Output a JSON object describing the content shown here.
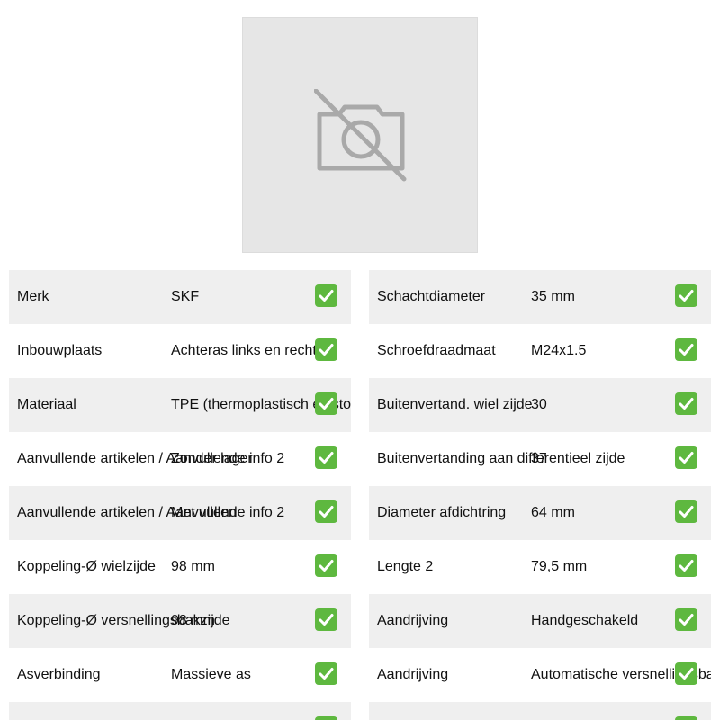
{
  "product": {
    "image_icon": "no-photo-icon"
  },
  "check_icon": "check-icon",
  "accent_color": "#5eb83f",
  "specs_left": [
    {
      "label": "Merk",
      "value": "SKF"
    },
    {
      "label": "Inbouwplaats",
      "value": "Achteras links en rechts"
    },
    {
      "label": "Materiaal",
      "value": "TPE (thermoplastisch elastomeer)"
    },
    {
      "label": "Aanvullende artikelen / Aanvullende info 2",
      "value": "Zonder lager"
    },
    {
      "label": "Aanvullende artikelen / Aanvullende info 2",
      "value": "Met vullen"
    },
    {
      "label": "Koppeling-Ø wielzijde",
      "value": "98 mm"
    },
    {
      "label": "Koppeling-Ø versnellingsbakzijde",
      "value": "98 mm"
    },
    {
      "label": "Asverbinding",
      "value": "Massieve as"
    },
    {
      "label": "",
      "value": ""
    }
  ],
  "specs_right": [
    {
      "label": "Schachtdiameter",
      "value": "35 mm"
    },
    {
      "label": "Schroefdraadmaat",
      "value": "M24x1.5"
    },
    {
      "label": "Buitenvertand. wiel zijde",
      "value": "30"
    },
    {
      "label": "Buitenvertanding aan differentieel zijde",
      "value": "37"
    },
    {
      "label": "Diameter afdichtring",
      "value": "64 mm"
    },
    {
      "label": "Lengte 2",
      "value": "79,5 mm"
    },
    {
      "label": "Aandrijving",
      "value": "Handgeschakeld"
    },
    {
      "label": "Aandrijving",
      "value": "Automatische versnellingsbak"
    },
    {
      "label": "",
      "value": ""
    }
  ]
}
